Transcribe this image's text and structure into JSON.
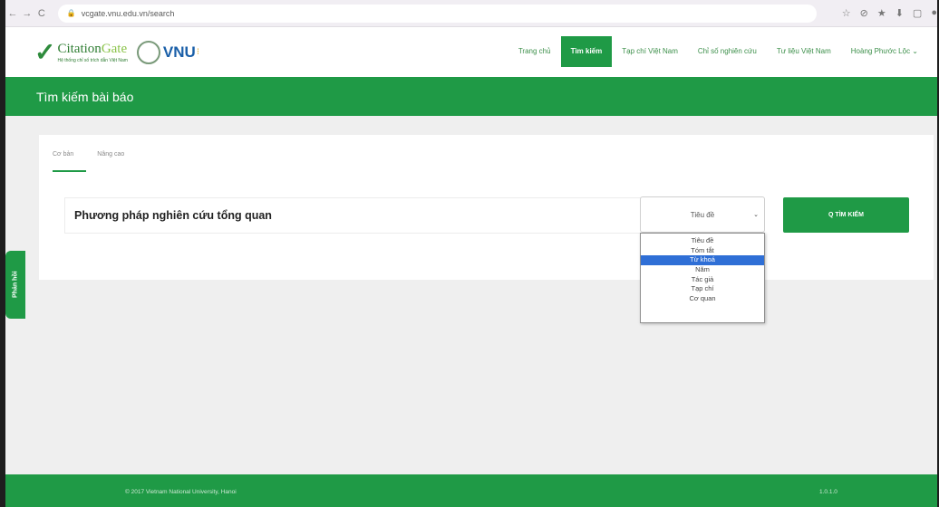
{
  "browser": {
    "url": "vcgate.vnu.edu.vn/search",
    "back": "←",
    "forward": "→",
    "reload": "C",
    "icons": [
      "☆",
      "⊘",
      "★",
      "⬇",
      "▢",
      "●"
    ]
  },
  "header": {
    "logo_name_a": "Citation",
    "logo_name_b": "Gate",
    "logo_tagline": "Hệ thống chỉ số trích dẫn Việt Nam",
    "vnu_label": "VNU",
    "vnu_dots": "⁝",
    "nav": [
      {
        "label": "Trang chủ"
      },
      {
        "label": "Tìm kiếm"
      },
      {
        "label": "Tạp chí Việt Nam"
      },
      {
        "label": "Chỉ số nghiên cứu"
      },
      {
        "label": "Tư liệu Việt Nam"
      },
      {
        "label": "Hoàng Phước Lộc ⌄"
      }
    ]
  },
  "page": {
    "title": "Tìm kiếm bài báo",
    "feedback": "Phản hồi"
  },
  "search": {
    "tabs": [
      "Cơ bản",
      "Nâng cao"
    ],
    "query": "Phương pháp nghiên cứu tổng quan",
    "field_selected": "Tiêu đề",
    "chevron": "⌄",
    "button_label": "Q TÌM KIẾM",
    "options": [
      "Tiêu đề",
      "Tóm tắt",
      "Từ khoá",
      "Năm",
      "Tác giả",
      "Tạp chí",
      "Cơ quan"
    ],
    "highlighted_option": "Từ khoá"
  },
  "footer": {
    "copyright": "© 2017 Vietnam National University, Hanoi",
    "version": "1.0.1.0"
  },
  "colors": {
    "brand_green": "#1f9a46",
    "highlight_blue": "#2f6fd6"
  }
}
